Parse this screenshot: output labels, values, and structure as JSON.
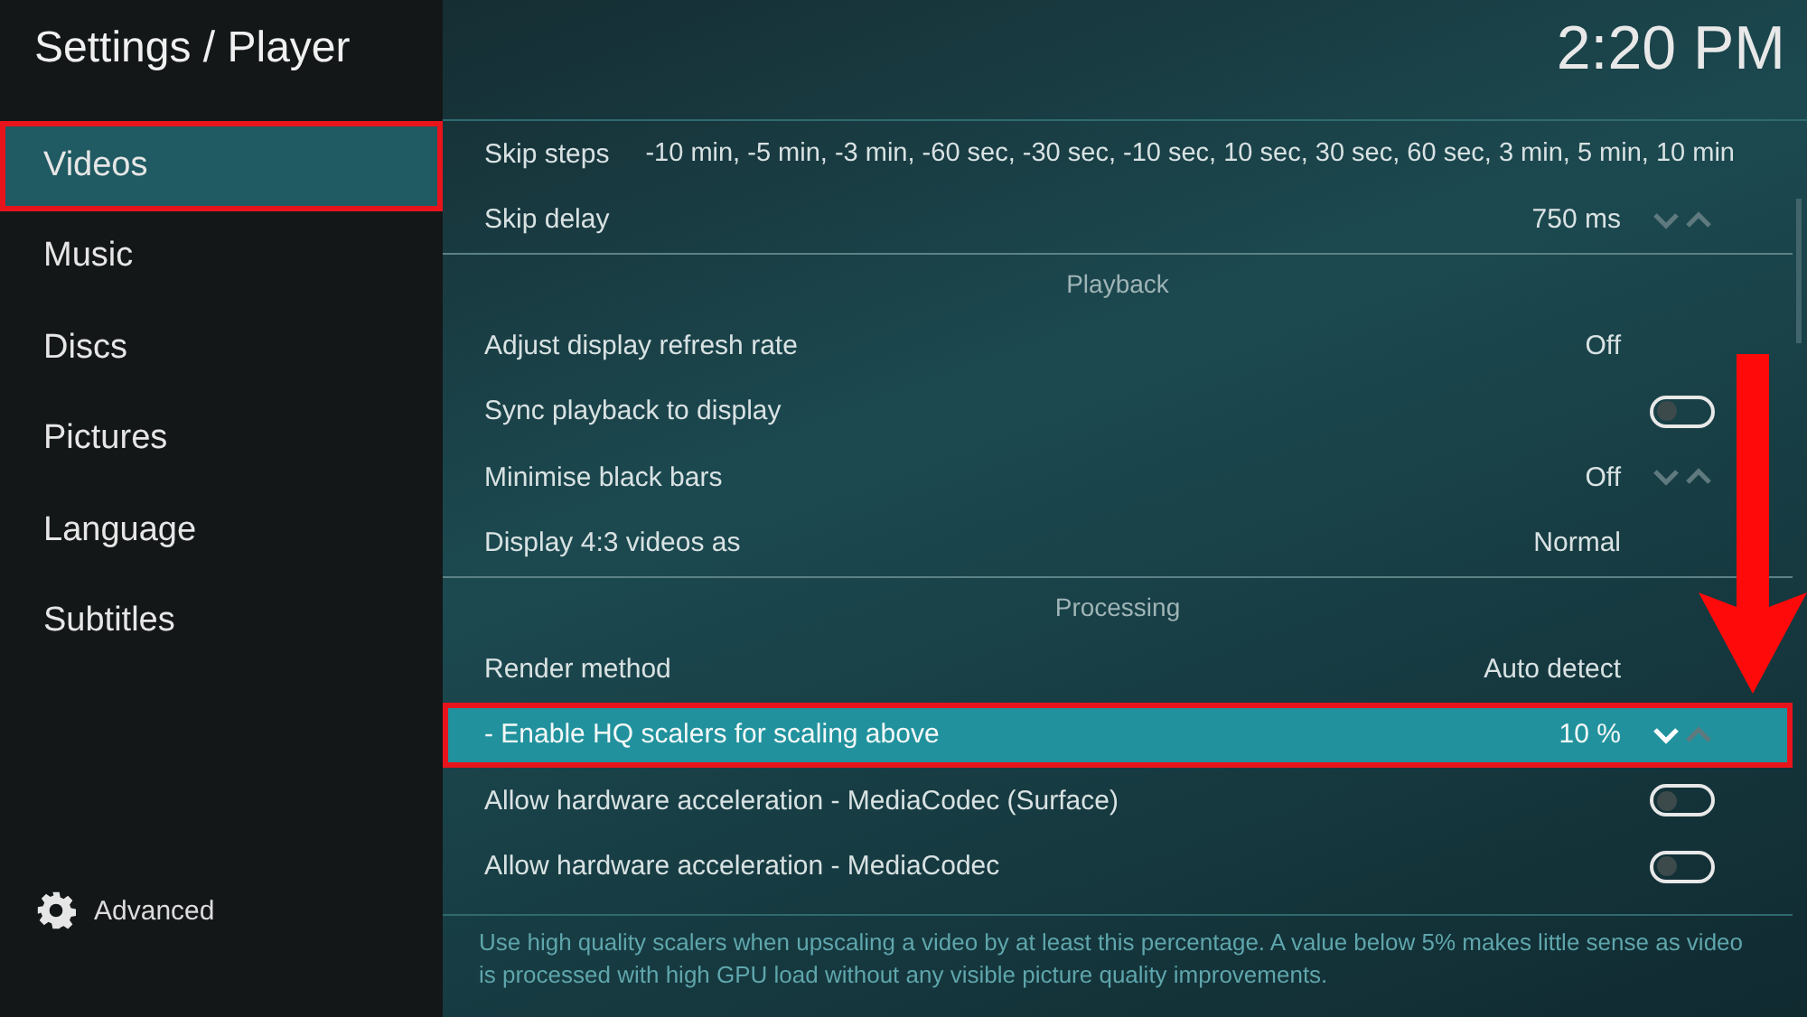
{
  "header": {
    "title": "Settings / Player",
    "clock": "2:20 PM"
  },
  "sidebar": {
    "items": [
      {
        "label": "Videos",
        "selected": true
      },
      {
        "label": "Music",
        "selected": false
      },
      {
        "label": "Discs",
        "selected": false
      },
      {
        "label": "Pictures",
        "selected": false
      },
      {
        "label": "Language",
        "selected": false
      },
      {
        "label": "Subtitles",
        "selected": false
      }
    ],
    "advanced": "Advanced"
  },
  "settings": [
    {
      "kind": "list",
      "label": "Skip steps",
      "value": "-10 min, -5 min, -3 min, -60 sec, -30 sec, -10 sec, 10 sec, 30 sec, 60 sec, 3 min, 5 min, 10 min",
      "selected": false
    },
    {
      "kind": "spinner",
      "label": "Skip delay",
      "value": "750 ms",
      "selected": false
    },
    {
      "kind": "section",
      "label": "Playback"
    },
    {
      "kind": "value",
      "label": "Adjust display refresh rate",
      "value": "Off",
      "selected": false
    },
    {
      "kind": "toggle",
      "label": "Sync playback to display",
      "on": false,
      "selected": false
    },
    {
      "kind": "spinner",
      "label": "Minimise black bars",
      "value": "Off",
      "selected": false
    },
    {
      "kind": "value",
      "label": "Display 4:3 videos as",
      "value": "Normal",
      "selected": false
    },
    {
      "kind": "section",
      "label": "Processing"
    },
    {
      "kind": "value",
      "label": "Render method",
      "value": "Auto detect",
      "selected": false
    },
    {
      "kind": "spinner",
      "label": "- Enable HQ scalers for scaling above",
      "value": "10 %",
      "selected": true
    },
    {
      "kind": "toggle",
      "label": "Allow hardware acceleration - MediaCodec (Surface)",
      "on": false,
      "selected": false
    },
    {
      "kind": "toggle",
      "label": "Allow hardware acceleration - MediaCodec",
      "on": false,
      "selected": false
    }
  ],
  "description": "Use high quality scalers when upscaling a video by at least this percentage. A value below 5% makes little sense as video is processed with high GPU load without any visible picture quality improvements."
}
